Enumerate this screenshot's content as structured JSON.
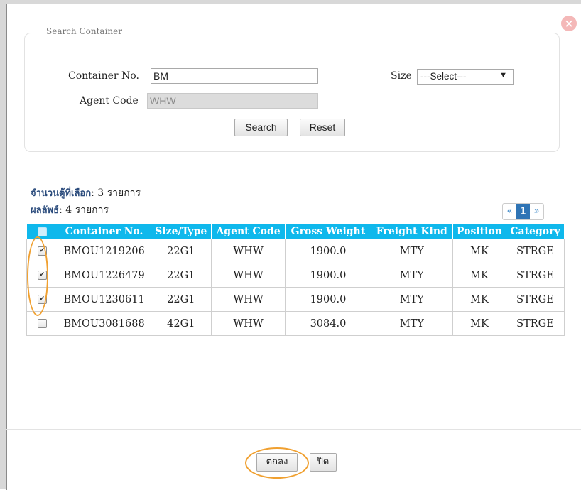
{
  "dialog": {
    "close_icon": "×"
  },
  "search": {
    "legend": "Search Container",
    "container_label": "Container No.",
    "container_value": "BM",
    "agent_label": "Agent Code",
    "agent_value": "WHW",
    "size_label": "Size",
    "size_selected": "---Select---",
    "size_arrow": "▼",
    "search_button": "Search",
    "reset_button": "Reset"
  },
  "summary": {
    "selected_label": "จำนวนตู้ที่เลือก",
    "selected_value": ": 3 รายการ",
    "result_label": "ผลลัพธ์",
    "result_value": ": 4 รายการ"
  },
  "pager": {
    "prev": "«",
    "page": "1",
    "next": "»"
  },
  "table": {
    "headers": [
      "Container No.",
      "Size/Type",
      "Agent Code",
      "Gross Weight",
      "Freight Kind",
      "Position",
      "Category"
    ],
    "rows": [
      {
        "checked": true,
        "cells": [
          "BMOU1219206",
          "22G1",
          "WHW",
          "1900.0",
          "MTY",
          "MK",
          "STRGE"
        ]
      },
      {
        "checked": true,
        "cells": [
          "BMOU1226479",
          "22G1",
          "WHW",
          "1900.0",
          "MTY",
          "MK",
          "STRGE"
        ]
      },
      {
        "checked": true,
        "cells": [
          "BMOU1230611",
          "22G1",
          "WHW",
          "1900.0",
          "MTY",
          "MK",
          "STRGE"
        ]
      },
      {
        "checked": false,
        "cells": [
          "BMOU3081688",
          "42G1",
          "WHW",
          "3084.0",
          "MTY",
          "MK",
          "STRGE"
        ]
      }
    ]
  },
  "footer": {
    "ok_button": "ตกลง",
    "close_button": "ปิด"
  },
  "colors": {
    "header_bg": "#0fb8ec",
    "highlight": "#f0a030",
    "pager_active": "#2f74b5"
  }
}
